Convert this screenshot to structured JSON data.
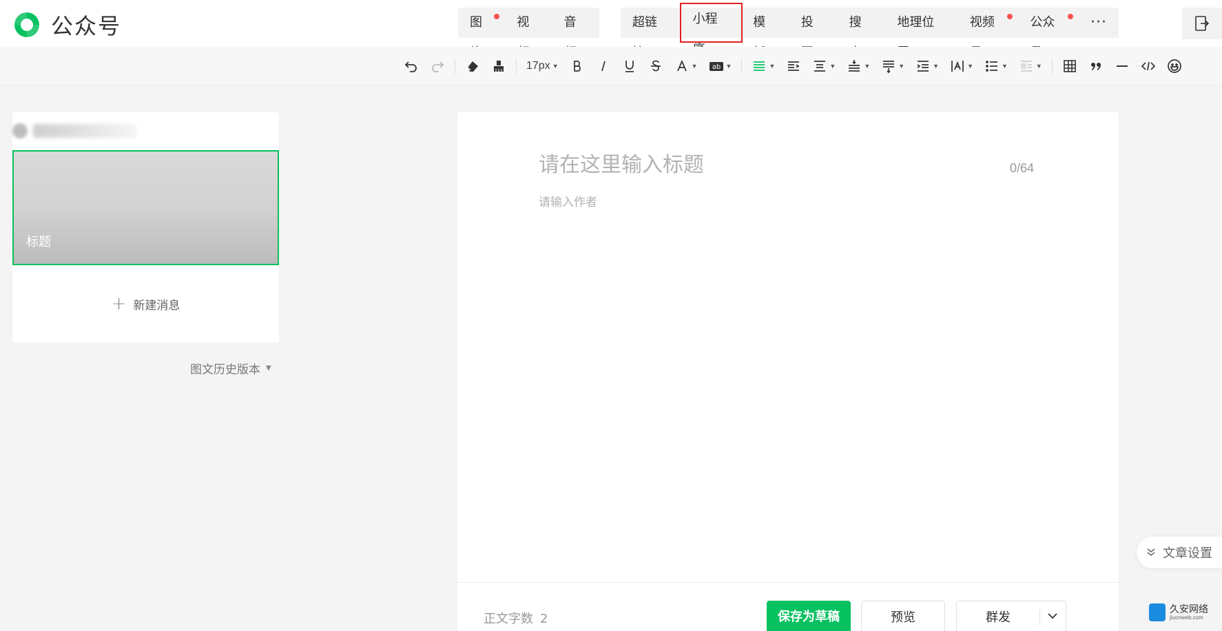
{
  "header": {
    "app_name": "公众号",
    "insert_media": [
      {
        "label": "图片",
        "dot": true
      },
      {
        "label": "视频",
        "dot": false
      },
      {
        "label": "音频",
        "dot": false
      }
    ],
    "insert_other": [
      {
        "label": "超链接",
        "dot": false
      },
      {
        "label": "小程序",
        "dot": false,
        "highlighted": true
      },
      {
        "label": "模板",
        "dot": false
      },
      {
        "label": "投票",
        "dot": false
      },
      {
        "label": "搜索",
        "dot": false
      },
      {
        "label": "地理位置",
        "dot": false
      },
      {
        "label": "视频号",
        "dot": true
      },
      {
        "label": "公众号",
        "dot": true
      }
    ],
    "more_label": "···"
  },
  "toolbar": {
    "font_size": "17px"
  },
  "sidebar": {
    "cover_title": "标题",
    "new_message_label": "新建消息",
    "history_label": "图文历史版本"
  },
  "editor": {
    "title_placeholder": "请在这里输入标题",
    "title_count": "0/64",
    "author_placeholder": "请输入作者"
  },
  "footer": {
    "wordcount_label": "正文字数",
    "wordcount_value": "2",
    "save_label": "保存为草稿",
    "preview_label": "预览",
    "publish_label": "群发"
  },
  "article_settings_label": "文章设置",
  "watermark": {
    "name": "久安网络",
    "url": "jiuonweb.com"
  },
  "colors": {
    "brand_green": "#07c160",
    "highlight_red": "#e02020",
    "dot_red": "#fa5151"
  }
}
